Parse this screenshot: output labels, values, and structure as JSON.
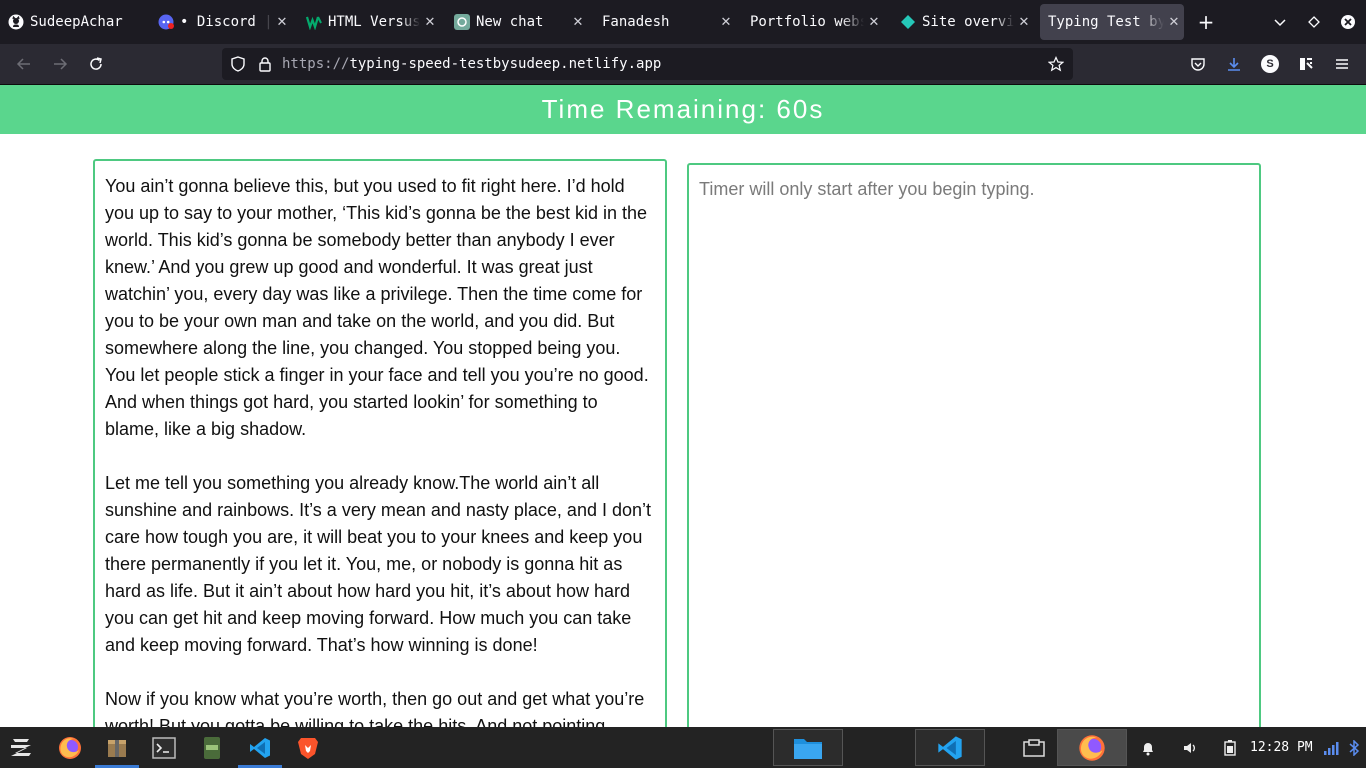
{
  "browser": {
    "tabs": [
      {
        "title": "SudeepAchar",
        "icon": "github-icon"
      },
      {
        "title": "• Discord | #",
        "icon": "discord-icon"
      },
      {
        "title": "HTML Versus",
        "icon": "w3-icon"
      },
      {
        "title": "New chat",
        "icon": "chatgpt-icon"
      },
      {
        "title": "Fanadesh",
        "icon": "blank-page-icon"
      },
      {
        "title": "Portfolio webs",
        "icon": "blank-page-icon"
      },
      {
        "title": "Site overview",
        "icon": "netlify-icon"
      },
      {
        "title": "Typing Test by",
        "icon": "blank-page-icon",
        "active": true
      }
    ],
    "url_protocol": "https://",
    "url_host": "typing-speed-testbysudeep.netlify.app",
    "profile_initial": "S"
  },
  "page": {
    "timer_label": "Time Remaining: 60s",
    "quote_paragraphs": [
      "You ain’t gonna believe this, but you used to fit right here. I’d hold you up to say to your mother, ‘This kid’s gonna be the best kid in the world. This kid’s gonna be somebody better than anybody I ever knew.’ And you grew up good and wonderful. It was great just watchin’ you, every day was like a privilege. Then the time come for you to be your own man and take on the world, and you did. But somewhere along the line, you changed. You stopped being you. You let people stick a finger in your face and tell you you’re no good. And when things got hard, you started lookin’ for something to blame, like a big shadow.",
      "Let me tell you something you already know.The world ain’t all sunshine and rainbows. It’s a very mean and nasty place, and I don’t care how tough you are, it will beat you to your knees and keep you there permanently if you let it. You, me, or nobody is gonna hit as hard as life. But it ain’t about how hard you hit, it’s about how hard you can get hit and keep moving forward. How much you can take and keep moving forward. That’s how winning is done!",
      "Now if you know what you’re worth, then go out and get what you’re worth! But you gotta be willing to take the hits. And not pointing"
    ],
    "input_placeholder": "Timer will only start after you begin typing.",
    "accent_color": "#5ad68d"
  },
  "taskbar": {
    "clock": "12:28 PM"
  }
}
